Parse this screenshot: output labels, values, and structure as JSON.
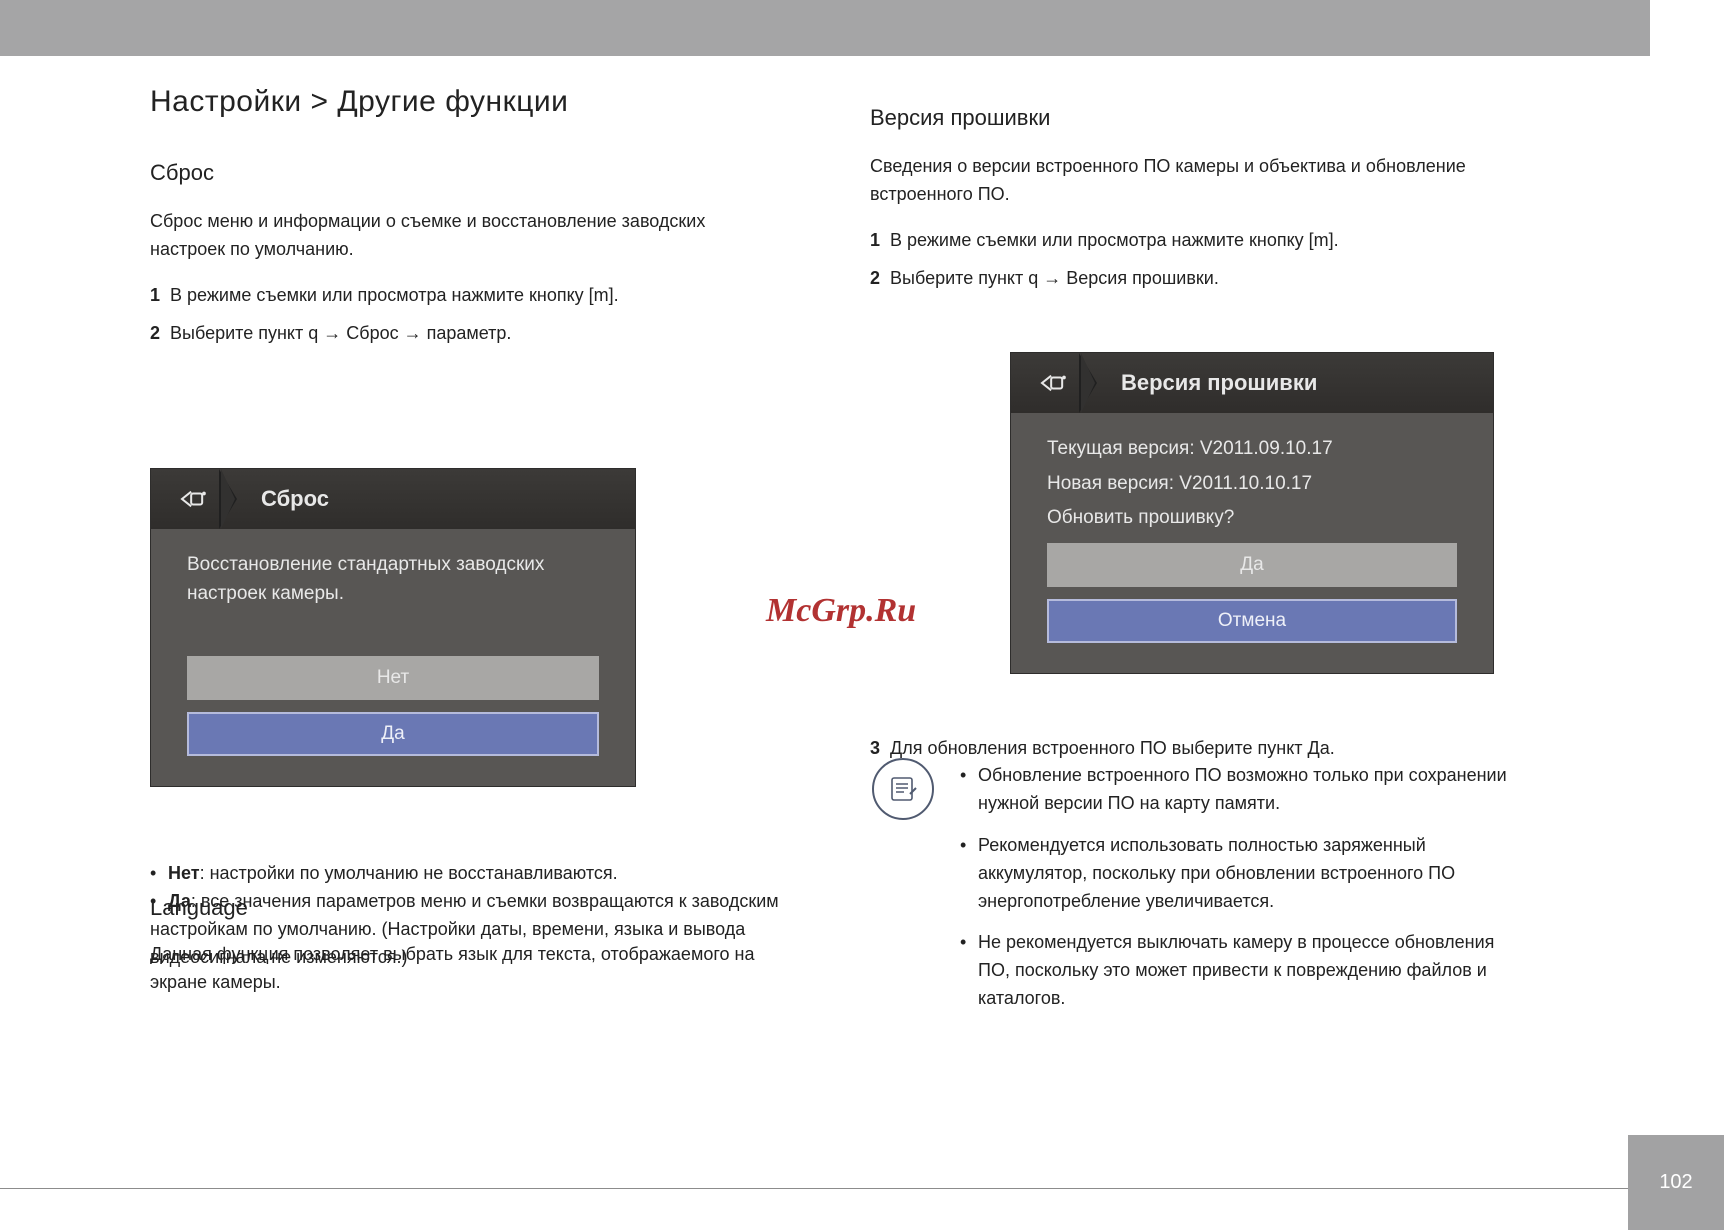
{
  "page_number": "102",
  "section": {
    "chapter": "Настройки",
    "title": "Другие функции"
  },
  "reset": {
    "heading": "Сброс",
    "intro": "Сброс меню и информации о съемке и восстановление заводских настроек по умолчанию.",
    "step1": "В режиме съемки или просмотра нажмите кнопку [m].",
    "step2_prefix": "Выберите пункт",
    "step2_choice": " q → Сброс → параметр."
  },
  "dialog_reset": {
    "title": "Сброс",
    "message": "Восстановление стандартных заводских настроек камеры.",
    "no": "Нет",
    "yes": "Да"
  },
  "reset_options": {
    "no_label": "Нет",
    "no_desc": ": настройки по умолчанию не восстанавливаются.",
    "yes_label": "Да",
    "yes_desc": ": все значения параметров меню и съемки возвращаются к заводским настройкам по умолчанию. (Настройки даты, времени, языка и вывода видеосигнала не изменяются.)"
  },
  "firmware": {
    "heading": "Версия прошивки",
    "intro": "Сведения о версии встроенного ПО камеры и объектива и обновление встроенного ПО.",
    "step1": "В режиме съемки или просмотра нажмите кнопку [m].",
    "step2": "Выберите пункт q → Версия прошивки."
  },
  "dialog_firmware": {
    "title": "Версия прошивки",
    "current_label": "Текущая версия:",
    "current_value": "V2011.09.10.17",
    "new_label": "Новая версия:",
    "new_value": "V2011.10.10.17",
    "prompt": "Обновить прошивку?",
    "yes": "Да",
    "cancel": "Отмена"
  },
  "firmware_steps_after": {
    "step3": "Для обновления встроенного ПО выберите пункт Да."
  },
  "firmware_notes": {
    "n1": "Обновление встроенного ПО возможно только при сохранении нужной версии ПО на карту памяти.",
    "n2": "Рекомендуется использовать полностью заряженный аккумулятор, поскольку при обновлении встроенного ПО энергопотребление увеличивается.",
    "n3": "Не рекомендуется выключать камеру в процессе обновления ПО, поскольку это может привести к повреждению файлов и каталогов."
  },
  "language": {
    "heading": "Language",
    "body": "Данная функция позволяет выбрать язык для текста, отображаемого на экране камеры."
  },
  "watermark": "McGrp.Ru"
}
